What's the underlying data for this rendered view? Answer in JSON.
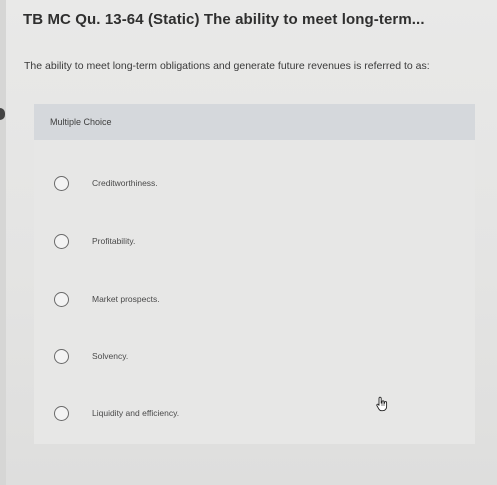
{
  "question": {
    "title": "TB MC Qu. 13-64 (Static) The ability to meet long-term...",
    "text": "The ability to meet long-term obligations and generate future revenues is referred to as:"
  },
  "choices_panel": {
    "header": "Multiple Choice",
    "options": [
      {
        "label": "Creditworthiness.",
        "selected": false
      },
      {
        "label": "Profitability.",
        "selected": false
      },
      {
        "label": "Market prospects.",
        "selected": false
      },
      {
        "label": "Solvency.",
        "selected": false
      },
      {
        "label": "Liquidity and efficiency.",
        "selected": false
      }
    ]
  },
  "icons": {
    "radio": "radio-unselected-icon",
    "pointer": "hand-pointer-icon"
  }
}
